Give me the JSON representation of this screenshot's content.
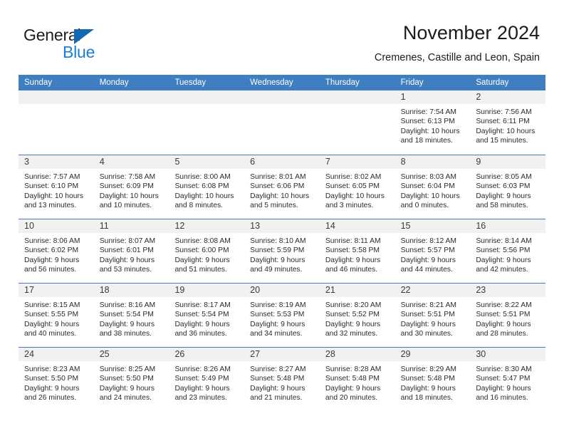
{
  "brand": {
    "word1": "General",
    "word2": "Blue",
    "triangle_color": "#1268b3",
    "blue_text_color": "#1a7fd4"
  },
  "header": {
    "title": "November 2024",
    "subtitle": "Cremenes, Castille and Leon, Spain"
  },
  "theme": {
    "header_blue": "#3f7fc1",
    "daynum_band": "#f1f1f1",
    "text": "#2b2b2b"
  },
  "calendar": {
    "weekdays": [
      "Sunday",
      "Monday",
      "Tuesday",
      "Wednesday",
      "Thursday",
      "Friday",
      "Saturday"
    ],
    "weeks": [
      [
        {
          "day": "",
          "lines": []
        },
        {
          "day": "",
          "lines": []
        },
        {
          "day": "",
          "lines": []
        },
        {
          "day": "",
          "lines": []
        },
        {
          "day": "",
          "lines": []
        },
        {
          "day": "1",
          "lines": [
            "Sunrise: 7:54 AM",
            "Sunset: 6:13 PM",
            "Daylight: 10 hours",
            "and 18 minutes."
          ]
        },
        {
          "day": "2",
          "lines": [
            "Sunrise: 7:56 AM",
            "Sunset: 6:11 PM",
            "Daylight: 10 hours",
            "and 15 minutes."
          ]
        }
      ],
      [
        {
          "day": "3",
          "lines": [
            "Sunrise: 7:57 AM",
            "Sunset: 6:10 PM",
            "Daylight: 10 hours",
            "and 13 minutes."
          ]
        },
        {
          "day": "4",
          "lines": [
            "Sunrise: 7:58 AM",
            "Sunset: 6:09 PM",
            "Daylight: 10 hours",
            "and 10 minutes."
          ]
        },
        {
          "day": "5",
          "lines": [
            "Sunrise: 8:00 AM",
            "Sunset: 6:08 PM",
            "Daylight: 10 hours",
            "and 8 minutes."
          ]
        },
        {
          "day": "6",
          "lines": [
            "Sunrise: 8:01 AM",
            "Sunset: 6:06 PM",
            "Daylight: 10 hours",
            "and 5 minutes."
          ]
        },
        {
          "day": "7",
          "lines": [
            "Sunrise: 8:02 AM",
            "Sunset: 6:05 PM",
            "Daylight: 10 hours",
            "and 3 minutes."
          ]
        },
        {
          "day": "8",
          "lines": [
            "Sunrise: 8:03 AM",
            "Sunset: 6:04 PM",
            "Daylight: 10 hours",
            "and 0 minutes."
          ]
        },
        {
          "day": "9",
          "lines": [
            "Sunrise: 8:05 AM",
            "Sunset: 6:03 PM",
            "Daylight: 9 hours",
            "and 58 minutes."
          ]
        }
      ],
      [
        {
          "day": "10",
          "lines": [
            "Sunrise: 8:06 AM",
            "Sunset: 6:02 PM",
            "Daylight: 9 hours",
            "and 56 minutes."
          ]
        },
        {
          "day": "11",
          "lines": [
            "Sunrise: 8:07 AM",
            "Sunset: 6:01 PM",
            "Daylight: 9 hours",
            "and 53 minutes."
          ]
        },
        {
          "day": "12",
          "lines": [
            "Sunrise: 8:08 AM",
            "Sunset: 6:00 PM",
            "Daylight: 9 hours",
            "and 51 minutes."
          ]
        },
        {
          "day": "13",
          "lines": [
            "Sunrise: 8:10 AM",
            "Sunset: 5:59 PM",
            "Daylight: 9 hours",
            "and 49 minutes."
          ]
        },
        {
          "day": "14",
          "lines": [
            "Sunrise: 8:11 AM",
            "Sunset: 5:58 PM",
            "Daylight: 9 hours",
            "and 46 minutes."
          ]
        },
        {
          "day": "15",
          "lines": [
            "Sunrise: 8:12 AM",
            "Sunset: 5:57 PM",
            "Daylight: 9 hours",
            "and 44 minutes."
          ]
        },
        {
          "day": "16",
          "lines": [
            "Sunrise: 8:14 AM",
            "Sunset: 5:56 PM",
            "Daylight: 9 hours",
            "and 42 minutes."
          ]
        }
      ],
      [
        {
          "day": "17",
          "lines": [
            "Sunrise: 8:15 AM",
            "Sunset: 5:55 PM",
            "Daylight: 9 hours",
            "and 40 minutes."
          ]
        },
        {
          "day": "18",
          "lines": [
            "Sunrise: 8:16 AM",
            "Sunset: 5:54 PM",
            "Daylight: 9 hours",
            "and 38 minutes."
          ]
        },
        {
          "day": "19",
          "lines": [
            "Sunrise: 8:17 AM",
            "Sunset: 5:54 PM",
            "Daylight: 9 hours",
            "and 36 minutes."
          ]
        },
        {
          "day": "20",
          "lines": [
            "Sunrise: 8:19 AM",
            "Sunset: 5:53 PM",
            "Daylight: 9 hours",
            "and 34 minutes."
          ]
        },
        {
          "day": "21",
          "lines": [
            "Sunrise: 8:20 AM",
            "Sunset: 5:52 PM",
            "Daylight: 9 hours",
            "and 32 minutes."
          ]
        },
        {
          "day": "22",
          "lines": [
            "Sunrise: 8:21 AM",
            "Sunset: 5:51 PM",
            "Daylight: 9 hours",
            "and 30 minutes."
          ]
        },
        {
          "day": "23",
          "lines": [
            "Sunrise: 8:22 AM",
            "Sunset: 5:51 PM",
            "Daylight: 9 hours",
            "and 28 minutes."
          ]
        }
      ],
      [
        {
          "day": "24",
          "lines": [
            "Sunrise: 8:23 AM",
            "Sunset: 5:50 PM",
            "Daylight: 9 hours",
            "and 26 minutes."
          ]
        },
        {
          "day": "25",
          "lines": [
            "Sunrise: 8:25 AM",
            "Sunset: 5:50 PM",
            "Daylight: 9 hours",
            "and 24 minutes."
          ]
        },
        {
          "day": "26",
          "lines": [
            "Sunrise: 8:26 AM",
            "Sunset: 5:49 PM",
            "Daylight: 9 hours",
            "and 23 minutes."
          ]
        },
        {
          "day": "27",
          "lines": [
            "Sunrise: 8:27 AM",
            "Sunset: 5:48 PM",
            "Daylight: 9 hours",
            "and 21 minutes."
          ]
        },
        {
          "day": "28",
          "lines": [
            "Sunrise: 8:28 AM",
            "Sunset: 5:48 PM",
            "Daylight: 9 hours",
            "and 20 minutes."
          ]
        },
        {
          "day": "29",
          "lines": [
            "Sunrise: 8:29 AM",
            "Sunset: 5:48 PM",
            "Daylight: 9 hours",
            "and 18 minutes."
          ]
        },
        {
          "day": "30",
          "lines": [
            "Sunrise: 8:30 AM",
            "Sunset: 5:47 PM",
            "Daylight: 9 hours",
            "and 16 minutes."
          ]
        }
      ]
    ]
  }
}
